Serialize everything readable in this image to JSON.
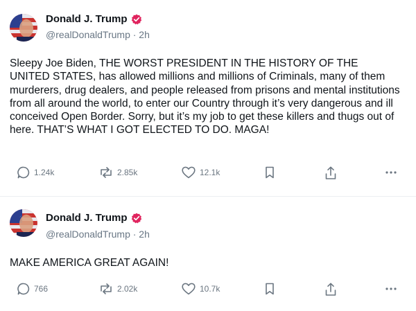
{
  "posts": [
    {
      "author": "Donald J. Trump",
      "handle": "@realDonaldTrump",
      "time": "· 2h",
      "text": "Sleepy Joe Biden, THE WORST PRESIDENT IN THE HISTORY OF THE UNITED STATES, has allowed millions and millions of Criminals, many of them murderers, drug dealers, and people released from prisons and mental institutions from all around the world, to enter our Country through it’s very dangerous and ill conceived Open Border. Sorry, but it’s my job to get these killers and thugs out of here. THAT’S WHAT I GOT ELECTED TO DO. MAGA!",
      "replies": "1.24k",
      "reposts": "2.85k",
      "likes": "12.1k"
    },
    {
      "author": "Donald J. Trump",
      "handle": "@realDonaldTrump",
      "time": "· 2h",
      "text": "MAKE AMERICA GREAT AGAIN!",
      "replies": "766",
      "reposts": "2.02k",
      "likes": "10.7k"
    }
  ],
  "colors": {
    "verified": "#e0245e",
    "icon_gray": "#6b7681",
    "text": "#0f1419",
    "secondary": "#687684"
  },
  "icons": {
    "reply": "comment-bubble-icon",
    "repost": "repost-arrows-icon",
    "like": "heart-icon",
    "bookmark": "bookmark-icon",
    "share": "share-upload-icon",
    "more": "more-dots-icon",
    "verified": "verified-badge-icon"
  }
}
